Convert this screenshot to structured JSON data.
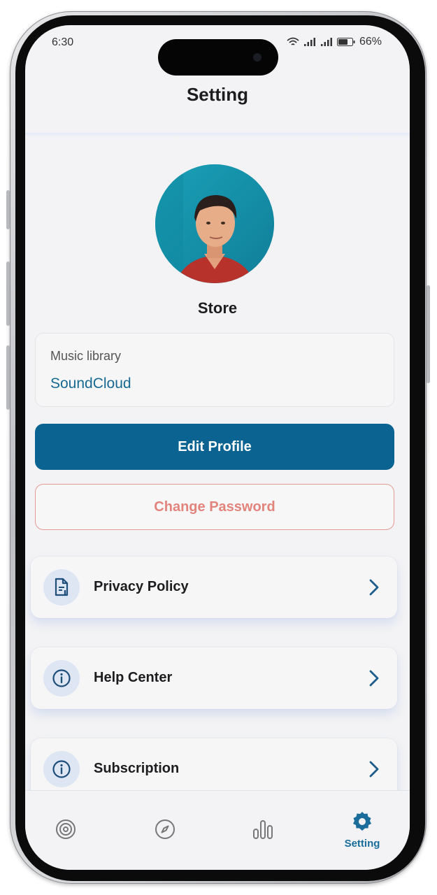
{
  "status_bar": {
    "time": "6:30",
    "battery": "66%"
  },
  "header": {
    "title": "Setting"
  },
  "profile": {
    "name": "Store"
  },
  "library": {
    "label": "Music library",
    "value": "SoundCloud"
  },
  "actions": {
    "edit_profile": "Edit Profile",
    "change_password": "Change Password"
  },
  "menu": [
    {
      "label": "Privacy Policy",
      "icon": "document-icon"
    },
    {
      "label": "Help Center",
      "icon": "info-icon"
    },
    {
      "label": "Subscription",
      "icon": "info-icon"
    }
  ],
  "tabs": [
    {
      "icon": "vinyl-icon",
      "label": ""
    },
    {
      "icon": "compass-icon",
      "label": ""
    },
    {
      "icon": "bar-chart-icon",
      "label": ""
    },
    {
      "icon": "gear-icon",
      "label": "Setting"
    }
  ],
  "colors": {
    "primary": "#0b6392",
    "accent_text": "#176991",
    "danger": "#e2847b",
    "background": "#f3f3f5"
  }
}
